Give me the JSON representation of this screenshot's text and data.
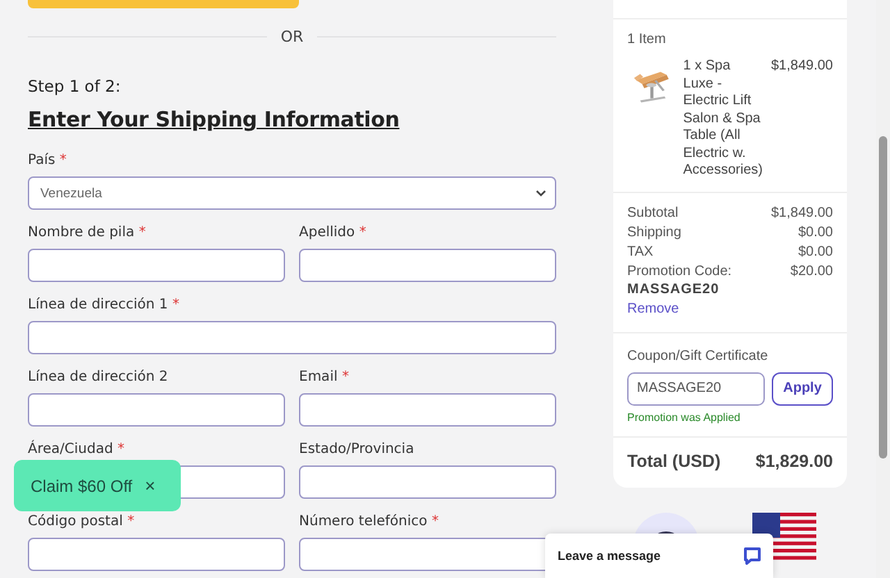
{
  "divider_text": "OR",
  "step": "Step 1 of 2:",
  "heading": "Enter Your Shipping Information",
  "rows": [
    [
      {
        "kind": "select",
        "label": "País",
        "required_mark": "*",
        "value": "Venezuela"
      }
    ],
    [
      {
        "kind": "text",
        "label": "Nombre de pila",
        "required_mark": "*"
      },
      {
        "kind": "text",
        "label": "Apellido",
        "required_mark": "*"
      }
    ],
    [
      {
        "kind": "text",
        "label": "Línea de dirección 1",
        "required_mark": "*"
      }
    ],
    [
      {
        "kind": "text",
        "label": "Línea de dirección 2"
      },
      {
        "kind": "text",
        "label": "Email",
        "required_mark": "*"
      }
    ],
    [
      {
        "kind": "text",
        "label": "Área/Ciudad",
        "required_mark": "*"
      },
      {
        "kind": "text",
        "label": "Estado/Provincia"
      }
    ],
    [
      {
        "kind": "text",
        "label": "Código postal",
        "required_mark": "*"
      },
      {
        "kind": "text",
        "label": "Número telefónico",
        "required_mark": "*"
      }
    ]
  ],
  "summary": {
    "item_count": "1 Item",
    "item": {
      "description": "1 x Spa Luxe - Electric Lift Salon & Spa Table (All Electric w. Accessories)",
      "price": "$1,849.00"
    },
    "lines": [
      {
        "label": "Subtotal",
        "value": "$1,849.00"
      },
      {
        "label": "Shipping",
        "value": "$0.00"
      },
      {
        "label": "TAX",
        "value": "$0.00"
      }
    ],
    "promo": {
      "label": "Promotion Code:",
      "code": "MASSAGE20",
      "value": "$20.00",
      "remove": "Remove"
    },
    "coupon": {
      "label": "Coupon/Gift Certificate",
      "value": "MASSAGE20",
      "button": "Apply",
      "status": "Promotion was Applied"
    },
    "total": {
      "label": "Total (USD)",
      "value": "$1,829.00"
    }
  },
  "claim_badge": {
    "text": "Claim $60 Off",
    "close": "×"
  },
  "chat": {
    "text": "Leave a message"
  }
}
